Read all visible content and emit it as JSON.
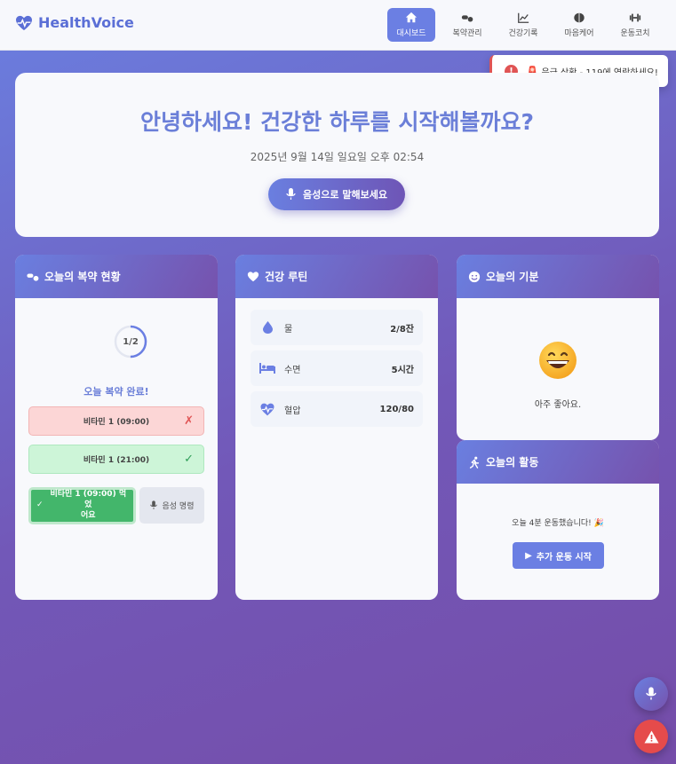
{
  "header": {
    "brand": "HealthVoice",
    "nav": [
      {
        "label": "대시보드",
        "icon": "home-icon",
        "active": true
      },
      {
        "label": "복약관리",
        "icon": "pills-icon",
        "active": false
      },
      {
        "label": "건강기록",
        "icon": "chart-line-icon",
        "active": false
      },
      {
        "label": "마음케어",
        "icon": "brain-icon",
        "active": false
      },
      {
        "label": "운동코치",
        "icon": "dumbbell-icon",
        "active": false
      }
    ]
  },
  "toast": {
    "bang": "!",
    "siren": "🚨",
    "message": "응급 상황 - 119에 연락하세요!"
  },
  "hero": {
    "title": "안녕하세요! 건강한 하루를 시작해볼까요?",
    "datetime": "2025년 9월 14일 일요일 오후 02:54",
    "voice_button": "음성으로 말해보세요"
  },
  "medication": {
    "title": "오늘의 복약 현황",
    "progress_label": "1/2",
    "progress_fraction": 0.5,
    "status": "오늘 복약 완료!",
    "items": [
      {
        "label": "비타민 1 (09:00)",
        "mark": "✗",
        "state": "missed"
      },
      {
        "label": "비타민 1 (21:00)",
        "mark": "✓",
        "state": "taken"
      }
    ],
    "take_button": "비타민 1 (09:00) 먹었어요",
    "take_button_line1": "비타민 1 (09:00) 먹었",
    "take_button_line2": "어요",
    "take_button_check": "✓",
    "command_button": "음성 명령"
  },
  "routine": {
    "title": "건강 루틴",
    "rows": [
      {
        "label": "물",
        "value": "2/8잔",
        "icon": "water-drop-icon"
      },
      {
        "label": "수면",
        "value": "5시간",
        "icon": "bed-icon"
      },
      {
        "label": "혈압",
        "value": "120/80",
        "icon": "heart-pulse-icon"
      }
    ]
  },
  "mood": {
    "title": "오늘의 기분",
    "text": "아주 좋아요."
  },
  "activity": {
    "title": "오늘의 활동",
    "text": "오늘 4분 운동했습니다! 🎉",
    "button": "추가 운동 시작",
    "button_icon": "▶"
  },
  "colors": {
    "accent": "#6b7fe3",
    "danger": "#e05454",
    "success": "#43b66b"
  }
}
